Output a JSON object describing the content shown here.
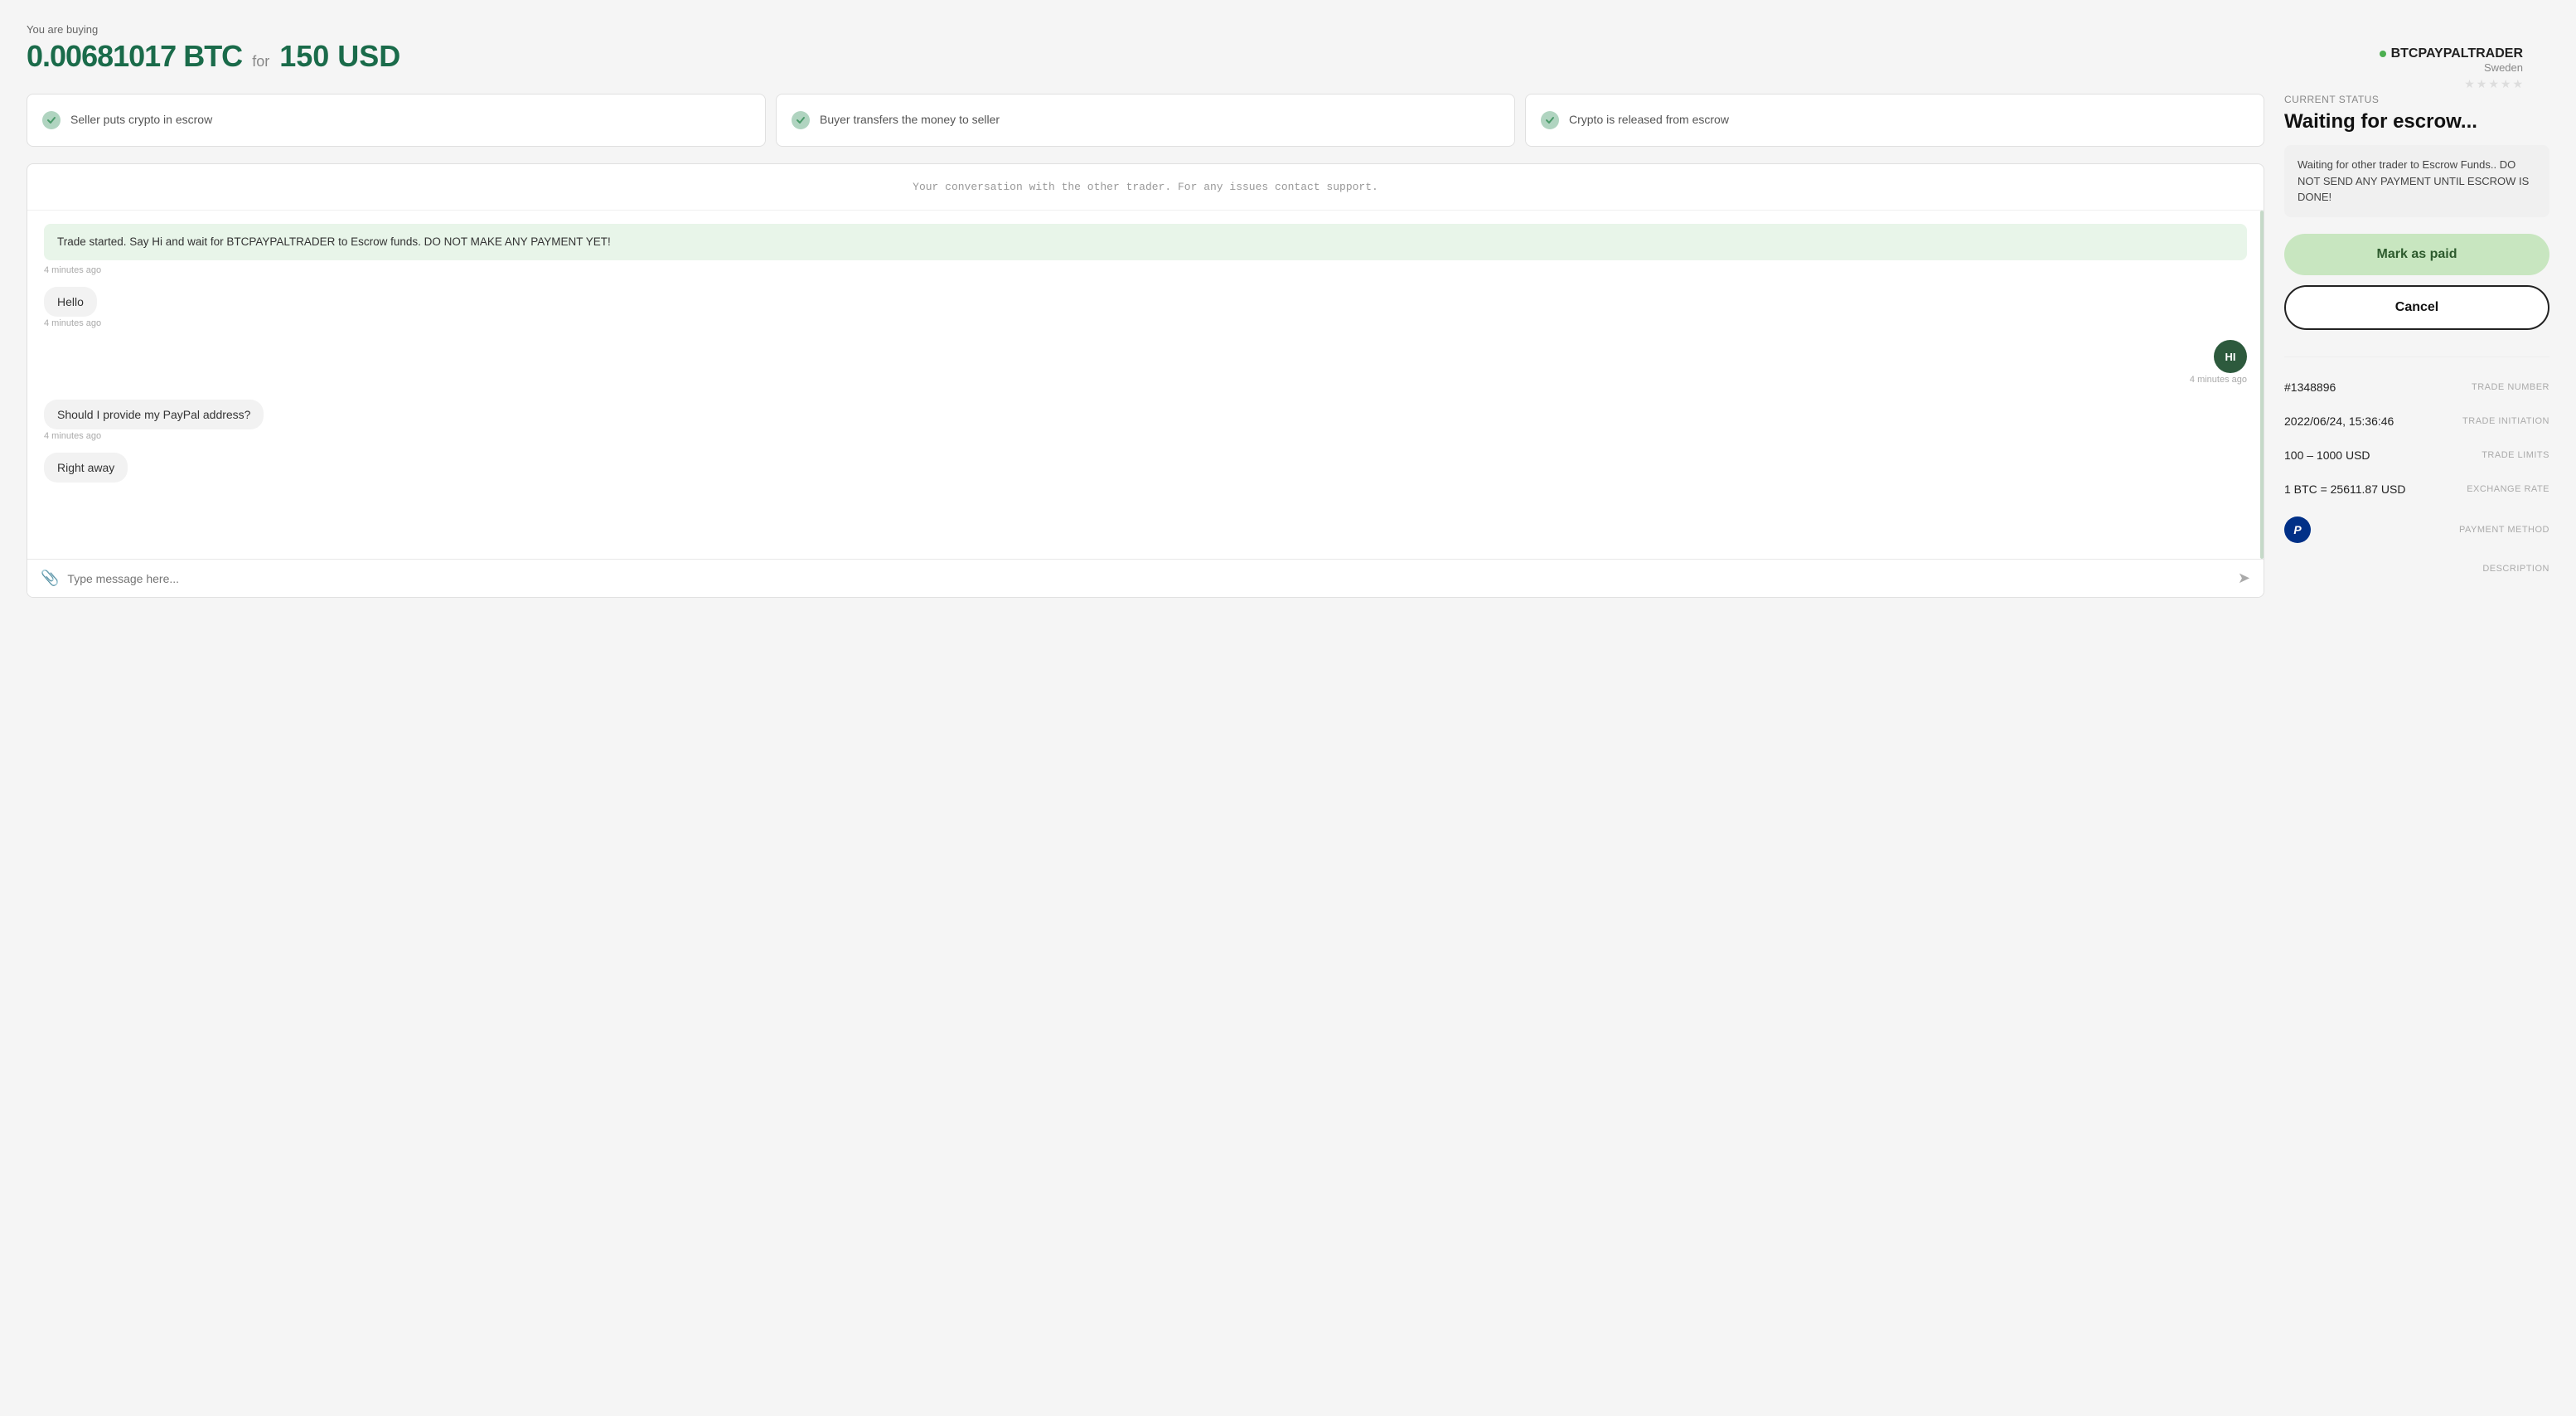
{
  "header": {
    "buying_label": "You are buying",
    "btc_amount": "0.00681017 BTC",
    "for_label": "for",
    "usd_amount": "150 USD"
  },
  "trader": {
    "name": "BTCPAYPALTRADER",
    "location": "Sweden",
    "stars": [
      false,
      false,
      false,
      false,
      false
    ]
  },
  "steps": [
    {
      "label": "Seller puts crypto in escrow"
    },
    {
      "label": "Buyer transfers the money to seller"
    },
    {
      "label": "Crypto is released from escrow"
    }
  ],
  "chat": {
    "notice": "Your conversation with the other trader. For any issues contact support.",
    "messages": [
      {
        "type": "system",
        "text": "Trade started. Say Hi and wait for BTCPAYPALTRADER to Escrow funds. DO NOT MAKE ANY PAYMENT YET!",
        "time": "4 minutes ago"
      },
      {
        "type": "left",
        "text": "Hello",
        "time": "4 minutes ago"
      },
      {
        "type": "right",
        "text": "HI",
        "time": "4 minutes ago"
      },
      {
        "type": "left",
        "text": "Should I provide my PayPal address?",
        "time": "4 minutes ago"
      },
      {
        "type": "left",
        "text": "Right away",
        "time": ""
      }
    ],
    "input_placeholder": "Type message here..."
  },
  "status": {
    "current_label": "CURRENT STATUS",
    "title": "Waiting for escrow...",
    "warning": "Waiting for other trader to Escrow Funds.. DO NOT SEND ANY PAYMENT UNTIL ESCROW IS DONE!",
    "btn_mark_paid": "Mark as paid",
    "btn_cancel": "Cancel"
  },
  "trade_details": [
    {
      "key": "TRADE NUMBER",
      "value": "#1348896"
    },
    {
      "key": "TRADE INITIATION",
      "value": "2022/06/24, 15:36:46"
    },
    {
      "key": "TRADE LIMITS",
      "value": "100 – 1000 USD"
    },
    {
      "key": "EXCHANGE RATE",
      "value": "1 BTC = 25611.87 USD"
    },
    {
      "key": "PAYMENT METHOD",
      "value": "paypal"
    },
    {
      "key": "DESCRIPTION",
      "value": ""
    }
  ]
}
